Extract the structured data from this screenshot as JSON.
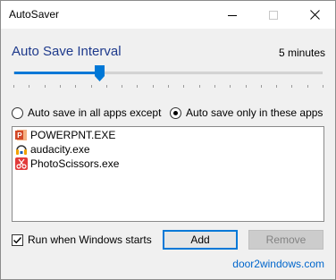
{
  "window": {
    "title": "AutoSaver"
  },
  "titlebar": {
    "minimize_icon": "minimize-icon",
    "maximize_icon": "maximize-icon",
    "close_icon": "close-icon"
  },
  "interval": {
    "title": "Auto Save Interval",
    "value_label": "5 minutes",
    "slider_position": 0.28,
    "tick_count": 20
  },
  "mode": {
    "options": [
      {
        "label": "Auto save in all apps except",
        "checked": false
      },
      {
        "label": "Auto save only in these apps",
        "checked": true
      }
    ]
  },
  "apps": {
    "items": [
      {
        "name": "POWERPNT.EXE",
        "icon": "powerpoint-icon"
      },
      {
        "name": "audacity.exe",
        "icon": "audacity-icon"
      },
      {
        "name": "PhotoScissors.exe",
        "icon": "photoscissors-icon"
      }
    ]
  },
  "options": {
    "run_on_start_label": "Run when Windows starts",
    "run_on_start_checked": true
  },
  "buttons": {
    "add_label": "Add",
    "remove_label": "Remove"
  },
  "footer": {
    "link_text": "door2windows.com"
  },
  "colors": {
    "accent": "#0078d7",
    "title_blue": "#1e3a8c",
    "link": "#0066cc"
  }
}
